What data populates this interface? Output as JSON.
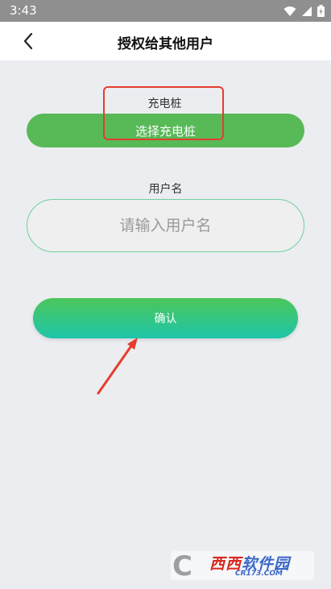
{
  "status_bar": {
    "time": "3:43",
    "icons": [
      "wifi-icon",
      "signal-icon",
      "battery-icon"
    ]
  },
  "header": {
    "title": "授权给其他用户",
    "back_icon": "chevron-left-icon"
  },
  "form": {
    "station_label": "充电桩",
    "station_button_label": "选择充电桩",
    "username_label": "用户名",
    "username_placeholder": "请输入用户名",
    "username_value": "",
    "confirm_label": "确认"
  },
  "watermark": {
    "logo_letter": "C",
    "main_red": "西西",
    "main_blue": "软件园",
    "sub": "CR173.COM"
  },
  "colors": {
    "status_bar_bg": "#8f8f8f",
    "accent_green": "#58b957",
    "confirm_gradient_top": "#4cc65a",
    "confirm_gradient_bottom": "#1ec5aa",
    "annotation_red": "#e53d2f",
    "page_bg": "#ebedf0"
  }
}
